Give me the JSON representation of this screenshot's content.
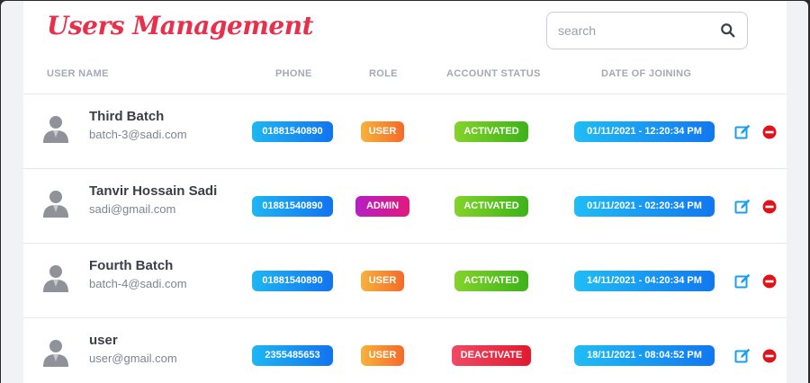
{
  "title": "Users Management",
  "search": {
    "placeholder": "search"
  },
  "columns": {
    "user_name": "USER NAME",
    "phone": "PHONE",
    "role": "ROLE",
    "status": "ACCOUNT STATUS",
    "date": "DATE OF JOINING"
  },
  "users": [
    {
      "name": "Third Batch",
      "email": "batch-3@sadi.com",
      "phone": "01881540890",
      "role": "USER",
      "status": "ACTIVATED",
      "date": "01/11/2021 - 12:20:34 PM"
    },
    {
      "name": "Tanvir Hossain Sadi",
      "email": "sadi@gmail.com",
      "phone": "01881540890",
      "role": "ADMIN",
      "status": "ACTIVATED",
      "date": "01/11/2021 - 02:20:34 PM"
    },
    {
      "name": "Fourth Batch",
      "email": "batch-4@sadi.com",
      "phone": "01881540890",
      "role": "USER",
      "status": "ACTIVATED",
      "date": "14/11/2021 - 04:20:34 PM"
    },
    {
      "name": "user",
      "email": "user@gmail.com",
      "phone": "2355485653",
      "role": "USER",
      "status": "DEACTIVATE",
      "date": "18/11/2021 - 08:04:52 PM"
    }
  ],
  "colors": {
    "title": "#e8304a",
    "phone_badge": "#1273f0",
    "role_user": "#f56a2a",
    "role_admin": "#b61ec4",
    "status_activated": "#3cb318",
    "status_deactivated": "#e01a30",
    "date_badge": "#1277f0",
    "edit_icon": "#1a9ef0",
    "delete_icon": "#e0131b"
  },
  "icons": {
    "search": "search-icon",
    "avatar": "user-avatar-icon",
    "edit": "edit-icon",
    "delete": "delete-icon"
  }
}
